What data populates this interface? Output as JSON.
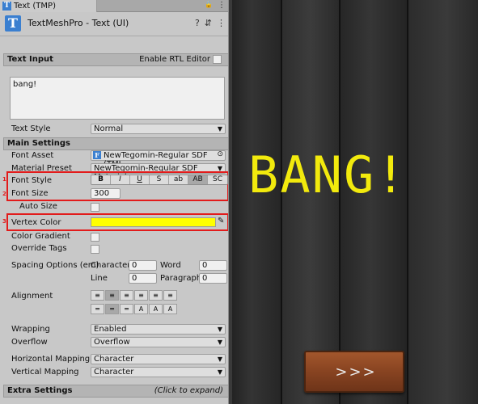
{
  "tab": {
    "title": "Text (TMP)",
    "lock_glyph": "🔒",
    "menu_glyph": "⋮"
  },
  "component": {
    "title": "TextMeshPro - Text (UI)",
    "help_glyph": "?",
    "preset_glyph": "⇵",
    "menu_glyph": "⋮"
  },
  "text_input": {
    "header": "Text Input",
    "rtl_label": "Enable RTL Editor",
    "text_value": "bang!",
    "text_style_label": "Text Style",
    "text_style_value": "Normal"
  },
  "main_settings": {
    "header": "Main Settings",
    "font_asset_label": "Font Asset",
    "font_asset_value": "NewTegomin-Regular SDF (TMI",
    "material_preset_label": "Material Preset",
    "material_preset_value": "NewTegomin-Regular SDF Material",
    "font_style_label": "Font Style",
    "font_style_buttons": [
      "B",
      "I",
      "U",
      "S",
      "ab",
      "AB",
      "SC"
    ],
    "font_size_label": "Font Size",
    "font_size_value": "300",
    "auto_size_label": "Auto Size",
    "vertex_color_label": "Vertex Color",
    "vertex_color": "#FFFF00",
    "color_gradient_label": "Color Gradient",
    "override_tags_label": "Override Tags",
    "spacing_label": "Spacing Options (em)",
    "character_label": "Character",
    "character_value": "0",
    "word_label": "Word",
    "word_value": "0",
    "line_label": "Line",
    "line_value": "0",
    "paragraph_label": "Paragraph",
    "paragraph_value": "0",
    "alignment_label": "Alignment",
    "wrapping_label": "Wrapping",
    "wrapping_value": "Enabled",
    "overflow_label": "Overflow",
    "overflow_value": "Overflow",
    "horizontal_mapping_label": "Horizontal Mapping",
    "horizontal_mapping_value": "Character",
    "vertical_mapping_label": "Vertical Mapping",
    "vertical_mapping_value": "Character"
  },
  "extra_settings": {
    "header": "Extra Settings",
    "hint": "(Click to expand)"
  },
  "annotations": [
    "1",
    "2",
    "3"
  ],
  "scene": {
    "bang_text": "BANG!",
    "next_button_label": ">>>"
  },
  "colors": {
    "annotation_red": "#e21b1b",
    "bang_yellow": "#f2ea0d",
    "accent_blue": "#3a7fd0"
  }
}
